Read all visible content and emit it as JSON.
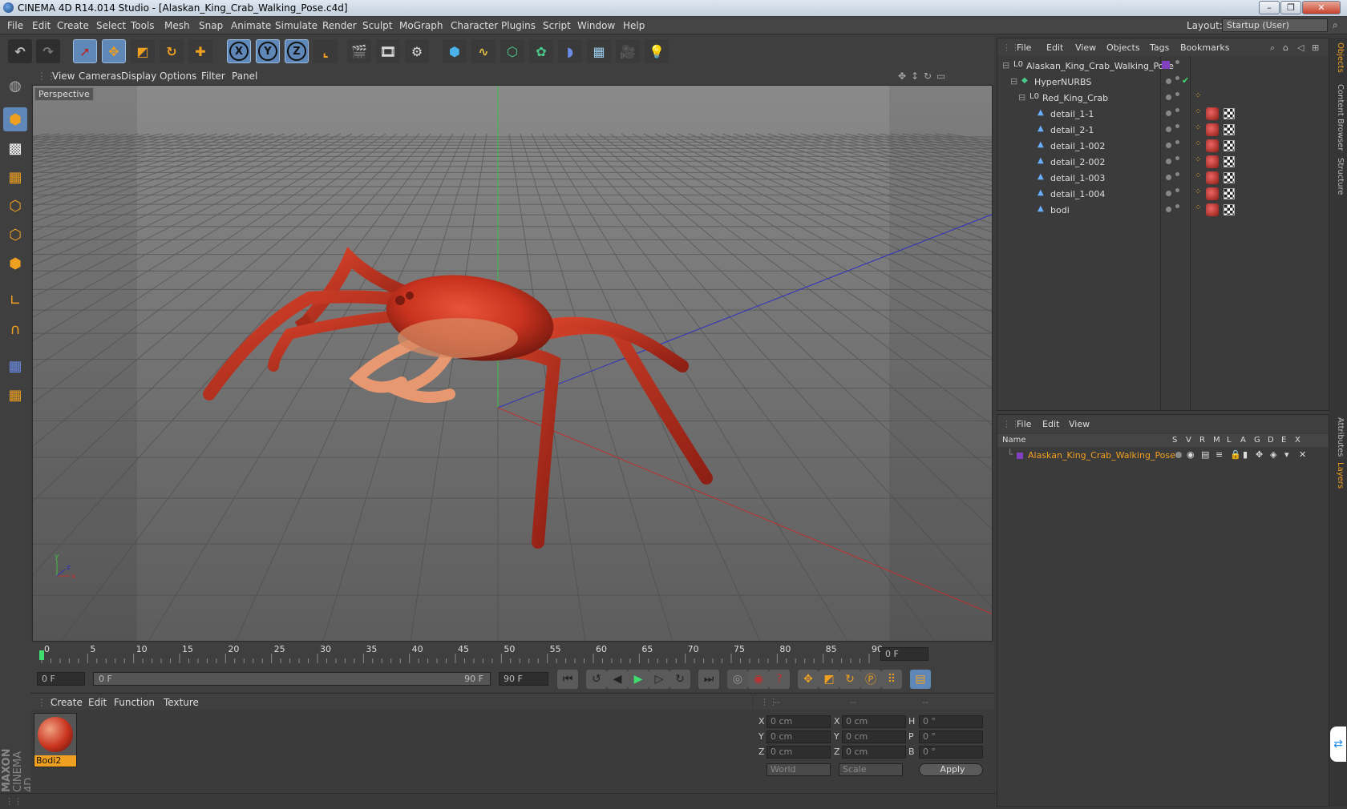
{
  "window": {
    "title": "CINEMA 4D R14.014 Studio - [Alaskan_King_Crab_Walking_Pose.c4d]",
    "min": "–",
    "max": "❐",
    "close": "✕"
  },
  "menu": [
    "File",
    "Edit",
    "Create",
    "Select",
    "Tools",
    "Mesh",
    "Snap",
    "Animate",
    "Simulate",
    "Render",
    "Sculpt",
    "MoGraph",
    "Character",
    "Plugins",
    "Script",
    "Window",
    "Help"
  ],
  "layout": {
    "label": "Layout:",
    "value": "Startup (User)"
  },
  "toolbar": {
    "x": "X",
    "y": "Y",
    "z": "Z"
  },
  "viewport": {
    "menu": [
      "View",
      "Cameras",
      "Display",
      "Options",
      "Filter",
      "Panel"
    ],
    "label": "Perspective"
  },
  "timeline": {
    "ticks": [
      "0",
      "5",
      "10",
      "15",
      "20",
      "25",
      "30",
      "35",
      "40",
      "45",
      "50",
      "55",
      "60",
      "65",
      "70",
      "75",
      "80",
      "85",
      "90"
    ],
    "current": "0 F"
  },
  "playback": {
    "start": "0 F",
    "range_start": "0 F",
    "range_end": "90 F",
    "end": "90 F"
  },
  "material": {
    "menu": [
      "Create",
      "Edit",
      "Function",
      "Texture"
    ],
    "name": "Bodi2"
  },
  "coords": {
    "rows": [
      {
        "a": "X",
        "av": "0 cm",
        "b": "X",
        "bv": "0 cm",
        "c": "H",
        "cv": "0 °"
      },
      {
        "a": "Y",
        "av": "0 cm",
        "b": "Y",
        "bv": "0 cm",
        "c": "P",
        "cv": "0 °"
      },
      {
        "a": "Z",
        "av": "0 cm",
        "b": "Z",
        "bv": "0 cm",
        "c": "B",
        "cv": "0 °"
      }
    ],
    "mode1": "World",
    "mode2": "Scale",
    "apply": "Apply",
    "h1": "--",
    "h2": "--",
    "h3": "--"
  },
  "objects": {
    "menu": [
      "File",
      "Edit",
      "View",
      "Objects",
      "Tags",
      "Bookmarks"
    ],
    "items": [
      {
        "name": "Alaskan_King_Crab_Walking_Pose",
        "indent": 0
      },
      {
        "name": "HyperNURBS",
        "indent": 1
      },
      {
        "name": "Red_King_Crab",
        "indent": 2
      },
      {
        "name": "detail_1-1",
        "indent": 3
      },
      {
        "name": "detail_2-1",
        "indent": 3
      },
      {
        "name": "detail_1-002",
        "indent": 3
      },
      {
        "name": "detail_2-002",
        "indent": 3
      },
      {
        "name": "detail_1-003",
        "indent": 3
      },
      {
        "name": "detail_1-004",
        "indent": 3
      },
      {
        "name": "bodi",
        "indent": 3
      }
    ]
  },
  "layers": {
    "menu": [
      "File",
      "Edit",
      "View"
    ],
    "header": {
      "name": "Name",
      "cols": [
        "S",
        "V",
        "R",
        "M",
        "L",
        "A",
        "G",
        "D",
        "E",
        "X"
      ]
    },
    "item": "Alaskan_King_Crab_Walking_Pose"
  },
  "righttabs": [
    "Objects",
    "Content Browser",
    "Structure",
    "Attributes",
    "Layers"
  ],
  "brand": {
    "top": "MAXON",
    "bottom": "CINEMA 4D"
  },
  "colors": {
    "accent": "#f0a020",
    "selection": "#5f88b8",
    "crab": "#c8321e"
  }
}
